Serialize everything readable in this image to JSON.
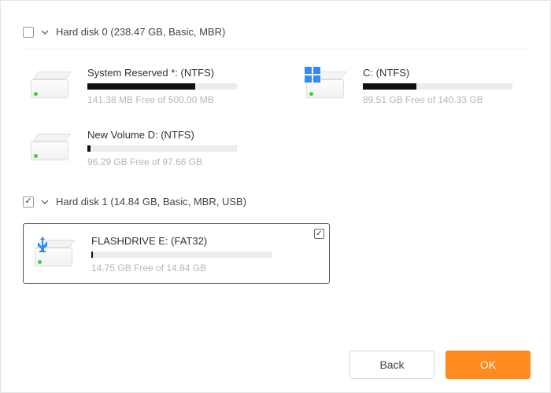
{
  "disks": [
    {
      "checked": false,
      "label": "Hard disk 0 (238.47 GB, Basic, MBR)",
      "partitions": [
        {
          "title": "System Reserved *: (NTFS)",
          "free_text": "141.38 MB Free of 500.00 MB",
          "fill_pct": 72,
          "icon": "plain"
        },
        {
          "title": "C: (NTFS)",
          "free_text": "89.51 GB Free of 140.33 GB",
          "fill_pct": 36,
          "icon": "windows"
        },
        {
          "title": "New Volume D: (NTFS)",
          "free_text": "96.29 GB Free of 97.66 GB",
          "fill_pct": 2,
          "icon": "plain"
        }
      ]
    },
    {
      "checked": true,
      "label": "Hard disk 1 (14.84 GB, Basic, MBR, USB)",
      "selected_partition": {
        "title": "FLASHDRIVE E: (FAT32)",
        "free_text": "14.75 GB Free of 14.84 GB",
        "fill_pct": 1,
        "icon": "usb"
      }
    }
  ],
  "buttons": {
    "back": "Back",
    "ok": "OK"
  }
}
